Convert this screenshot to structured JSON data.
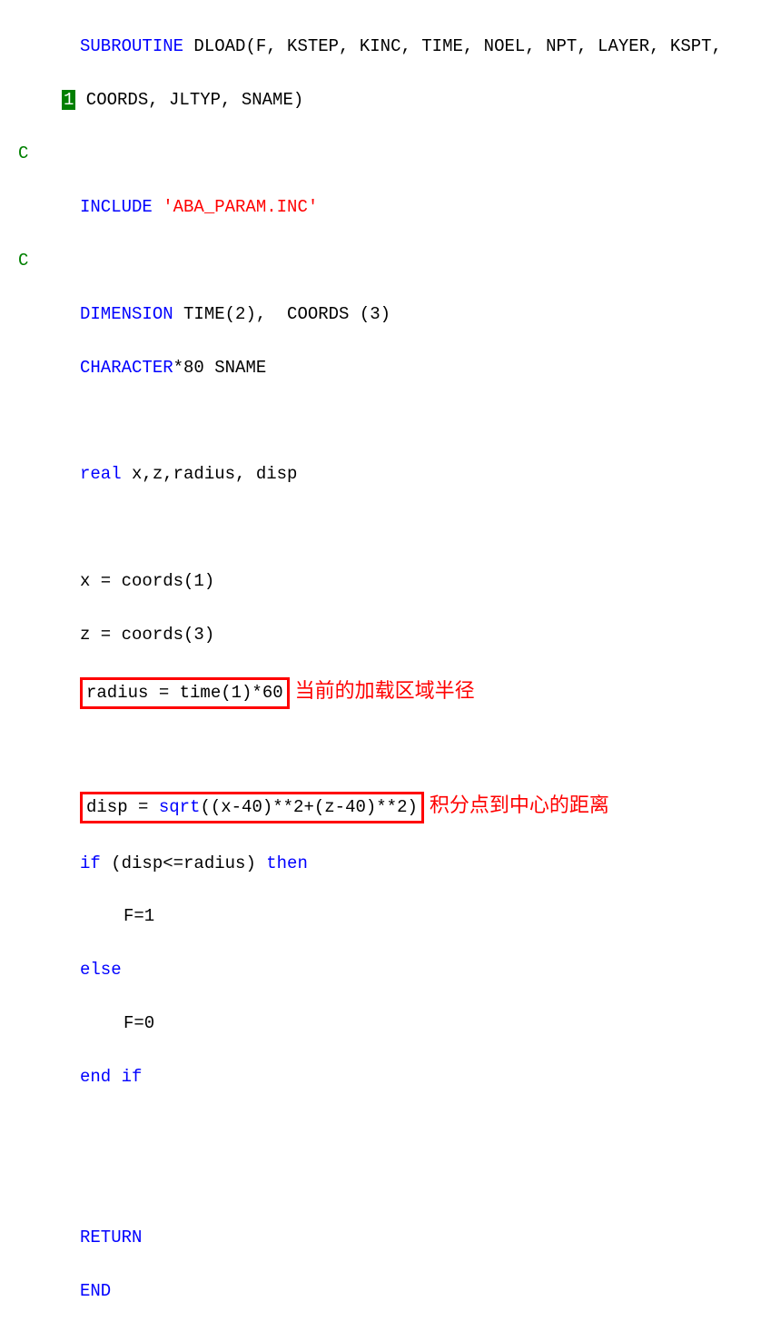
{
  "code": {
    "l1a": "SUBROUTINE",
    "l1b": " DLOAD(F, KSTEP, KINC, TIME, NOEL, NPT, LAYER, KSPT,",
    "cont": "1",
    "l2": " COORDS, JLTYP, SNAME)",
    "c1": "C",
    "l3a": "INCLUDE ",
    "l3b": "'ABA_PARAM.INC'",
    "c2": "C",
    "l4a": "DIMENSION",
    "l4b": " TIME(2),  COORDS (3)",
    "l5a": "CHARACTER",
    "l5b": "*80 SNAME",
    "l6a": "real",
    "l6b": " x,z,radius, disp",
    "l7": "x = coords(1)",
    "l8": "z = coords(3)",
    "l9": "radius = time(1)*60",
    "annot1": "当前的加载区域半径",
    "l10a": "disp = ",
    "l10b": "sqrt",
    "l10c": "((x-40)**2+(z-40)**2)",
    "annot2": "积分点到中心的距离",
    "l11a": "if",
    "l11b": " (disp<=radius) ",
    "l11c": "then",
    "l12": "F=1",
    "l13": "else",
    "l14": "F=0",
    "l15": "end if",
    "l16": "RETURN",
    "l17": "END"
  }
}
